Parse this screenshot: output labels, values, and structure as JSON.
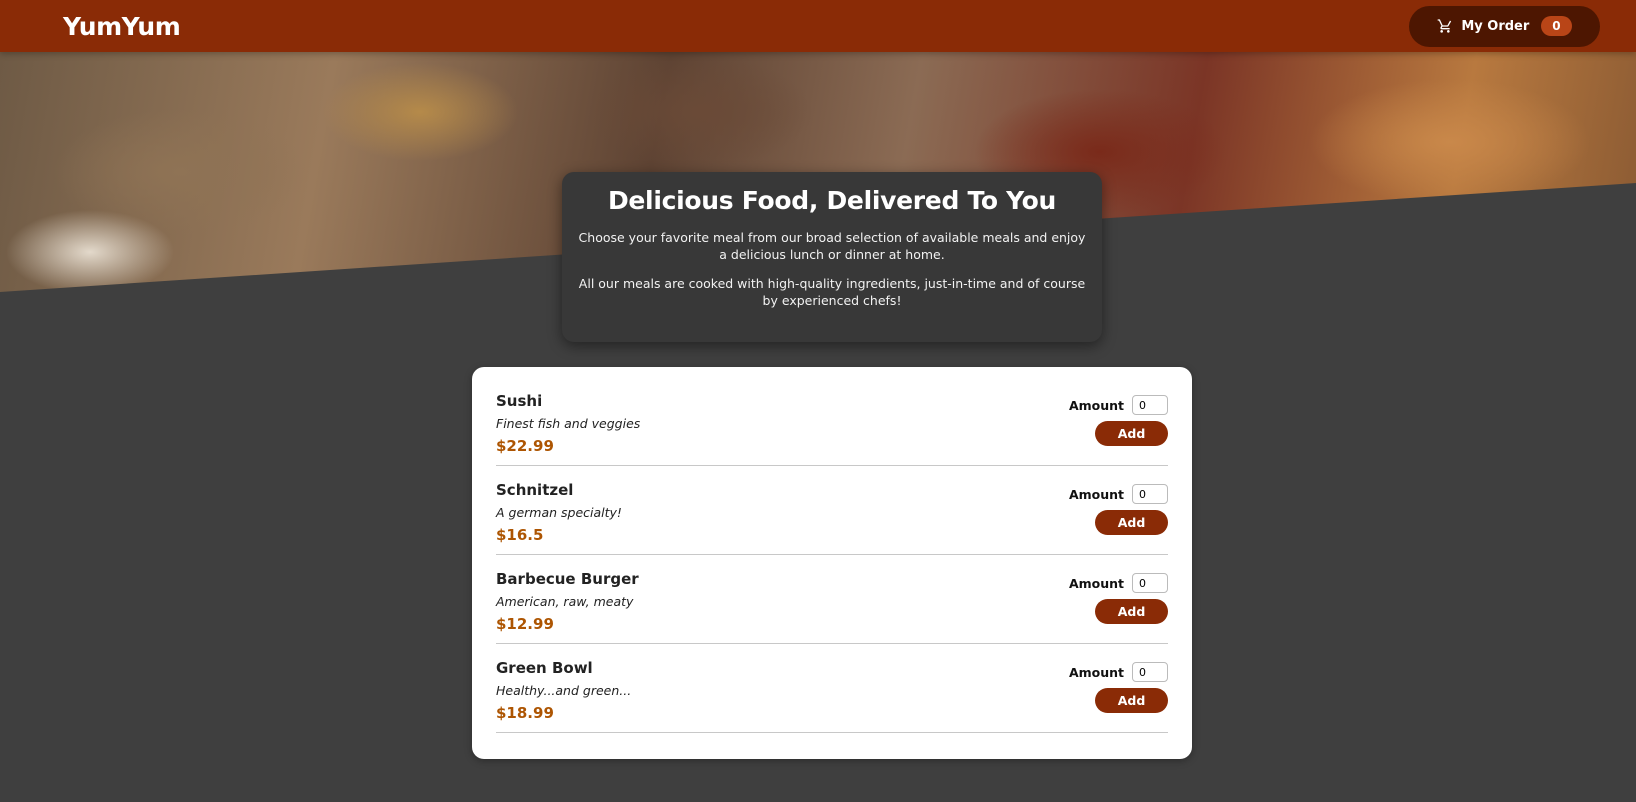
{
  "header": {
    "brand": "YumYum",
    "cart_label": "My Order",
    "cart_count": "0",
    "cart_icon": "cart-icon"
  },
  "hero": {
    "image": "buffet-food-table-photo"
  },
  "summary": {
    "title": "Delicious Food, Delivered To You",
    "paragraph_1": "Choose your favorite meal from our broad selection of available meals and enjoy a delicious lunch or dinner at home.",
    "paragraph_2": "All our meals are cooked with high-quality ingredients, just-in-time and of course by experienced chefs!"
  },
  "meals": [
    {
      "name": "Sushi",
      "description": "Finest fish and veggies",
      "price": "$22.99",
      "amount_label": "Amount",
      "amount_value": "0",
      "add_label": "Add"
    },
    {
      "name": "Schnitzel",
      "description": "A german specialty!",
      "price": "$16.5",
      "amount_label": "Amount",
      "amount_value": "0",
      "add_label": "Add"
    },
    {
      "name": "Barbecue Burger",
      "description": "American, raw, meaty",
      "price": "$12.99",
      "amount_label": "Amount",
      "amount_value": "0",
      "add_label": "Add"
    },
    {
      "name": "Green Bowl",
      "description": "Healthy...and green...",
      "price": "$18.99",
      "amount_label": "Amount",
      "amount_value": "0",
      "add_label": "Add"
    }
  ],
  "colors": {
    "header_bg": "#8a2b06",
    "cart_button_bg": "#4d1601",
    "badge_bg": "#b94517",
    "page_bg": "#3f3f3f",
    "summary_bg": "#383838",
    "price": "#ad5502"
  }
}
